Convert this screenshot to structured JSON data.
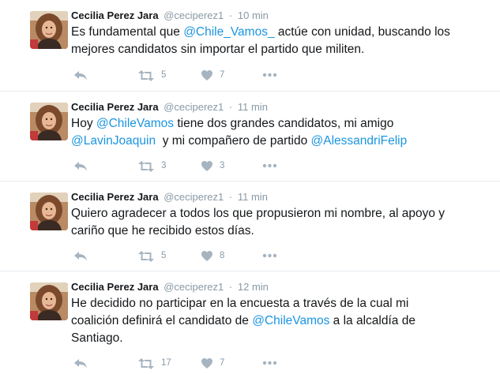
{
  "tweets": [
    {
      "name": "Cecilia Perez Jara",
      "handle": "@ceciperez1",
      "separator": "·",
      "time": "10 min",
      "line1_pre": "Es fundamental que ",
      "line1_mention": "@Chile_Vamos_",
      "line1_post": " actúe con unidad, buscando los",
      "line2": "mejores candidatos sin importar el partido que militen.",
      "retweets": "5",
      "likes": "7"
    },
    {
      "name": "Cecilia Perez Jara",
      "handle": "@ceciperez1",
      "separator": "·",
      "time": "11 min",
      "line1_pre": "Hoy ",
      "line1_mention": "@ChileVamos",
      "line1_post": " tiene dos grandes candidatos, mi amigo",
      "line2_mention1": "@LavinJoaquin",
      "line2_mid": "  y mi compañero de partido ",
      "line2_mention2": "@AlessandriFelip",
      "retweets": "3",
      "likes": "3"
    },
    {
      "name": "Cecilia Perez Jara",
      "handle": "@ceciperez1",
      "separator": "·",
      "time": "11 min",
      "line1": "Quiero agradecer a todos los que propusieron mi nombre, al apoyo y",
      "line2": "cariño que he recibido estos días.",
      "retweets": "5",
      "likes": "8"
    },
    {
      "name": "Cecilia Perez Jara",
      "handle": "@ceciperez1",
      "separator": "·",
      "time": "12 min",
      "line1": "He decidido no participar en la encuesta a través de la cual mi",
      "line2_pre": "coalición definirá el candidato de ",
      "line2_mention": "@ChileVamos",
      "line2_post": " a la alcaldía de",
      "line3": "Santiago.",
      "retweets": "17",
      "likes": "7"
    }
  ],
  "icons": {
    "reply": "reply-icon",
    "retweet": "retweet-icon",
    "like": "heart-icon",
    "more": "more-icon"
  },
  "colors": {
    "mention": "#1b95e0",
    "muted": "#8899a6",
    "divider": "#e6ecf0"
  }
}
